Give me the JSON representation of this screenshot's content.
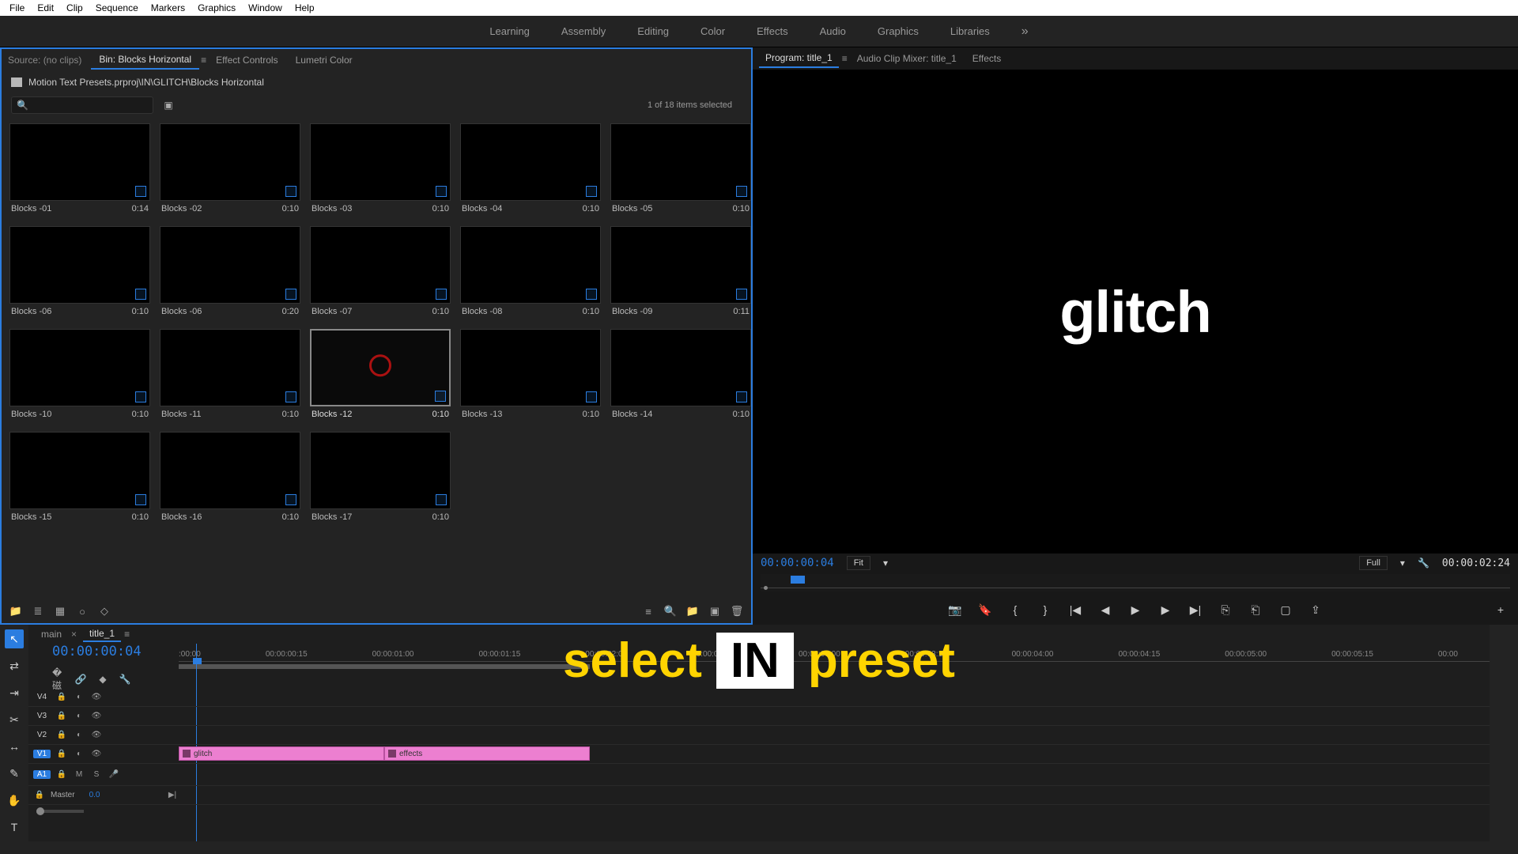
{
  "menu": {
    "items": [
      "File",
      "Edit",
      "Clip",
      "Sequence",
      "Markers",
      "Graphics",
      "Window",
      "Help"
    ]
  },
  "workspaces": {
    "items": [
      "Learning",
      "Assembly",
      "Editing",
      "Color",
      "Effects",
      "Audio",
      "Graphics",
      "Libraries"
    ]
  },
  "source": {
    "label": "Source: (no clips)",
    "tabs": {
      "bin": "Bin: Blocks Horizontal",
      "effect_controls": "Effect Controls",
      "lumetri": "Lumetri Color"
    },
    "breadcrumb": "Motion Text Presets.prproj\\IN\\GLITCH\\Blocks Horizontal",
    "selected_text": "1 of 18 items selected"
  },
  "bin": {
    "items": [
      {
        "name": "Blocks -01",
        "dur": "0:14"
      },
      {
        "name": "Blocks -02",
        "dur": "0:10"
      },
      {
        "name": "Blocks -03",
        "dur": "0:10"
      },
      {
        "name": "Blocks -04",
        "dur": "0:10"
      },
      {
        "name": "Blocks -05",
        "dur": "0:10"
      },
      {
        "name": "Blocks -06",
        "dur": "0:10"
      },
      {
        "name": "Blocks -06",
        "dur": "0:20"
      },
      {
        "name": "Blocks -07",
        "dur": "0:10"
      },
      {
        "name": "Blocks -08",
        "dur": "0:10"
      },
      {
        "name": "Blocks -09",
        "dur": "0:11"
      },
      {
        "name": "Blocks -10",
        "dur": "0:10"
      },
      {
        "name": "Blocks -11",
        "dur": "0:10"
      },
      {
        "name": "Blocks -12",
        "dur": "0:10"
      },
      {
        "name": "Blocks -13",
        "dur": "0:10"
      },
      {
        "name": "Blocks -14",
        "dur": "0:10"
      },
      {
        "name": "Blocks -15",
        "dur": "0:10"
      },
      {
        "name": "Blocks -16",
        "dur": "0:10"
      },
      {
        "name": "Blocks -17",
        "dur": "0:10"
      }
    ],
    "selected_index": 12
  },
  "program": {
    "tab": "Program: title_1",
    "tab2": "Audio Clip Mixer: title_1",
    "tab3": "Effects",
    "monitor_text": "glitch",
    "tc_left": "00:00:00:04",
    "fit": "Fit",
    "res": "Full",
    "tc_right": "00:00:02:24"
  },
  "timeline": {
    "tabs": {
      "main": "main",
      "title": "title_1"
    },
    "tc": "00:00:00:04",
    "ruler": [
      ":00:00",
      "00:00:00:15",
      "00:00:01:00",
      "00:00:01:15",
      "00:00:02:00",
      "00:00:02:15",
      "00:00:03:00",
      "00:00:03:15",
      "00:00:04:00",
      "00:00:04:15",
      "00:00:05:00",
      "00:00:05:15",
      "00:00"
    ],
    "tracks": {
      "v4": "V4",
      "v3": "V3",
      "v2": "V2",
      "v1": "V1",
      "a1": "A1",
      "master": "Master",
      "master_val": "0.0",
      "lock": "🔒",
      "eye": "👁",
      "mute": "M",
      "solo": "S",
      "mic": "🎤"
    },
    "clips": {
      "c1": "glitch",
      "c2": "effects"
    }
  },
  "overlay": {
    "w1": "select",
    "w2": "IN",
    "w3": "preset"
  },
  "icons": {
    "menu": "≡",
    "more": "»",
    "search": "🔍",
    "newitem": "▣",
    "camera": "📷",
    "marker": "🔖",
    "inpt": "{",
    "outpt": "}",
    "gostart": "|◀",
    "stepback": "◀",
    "play": "▶",
    "stepfwd": "▶",
    "goend": "▶|",
    "lift": "⎘",
    "extract": "⎗",
    "export": "⇪",
    "plus": "+",
    "trash": "🗑",
    "folder": "📁",
    "list": "≣",
    "grid": "▦",
    "wrench": "🔧",
    "arrow": "↖",
    "ripple": "⇄",
    "razor": "✂",
    "slip": "↔",
    "pen": "✎",
    "hand": "✋",
    "type": "T"
  }
}
